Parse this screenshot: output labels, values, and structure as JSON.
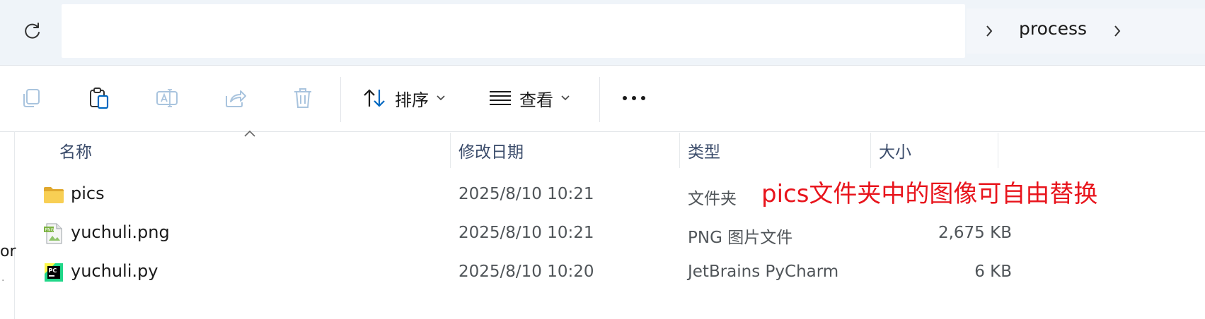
{
  "address_bar": {
    "value": "",
    "breadcrumb": [
      "process"
    ]
  },
  "toolbar": {
    "sort_label": "排序",
    "view_label": "查看"
  },
  "icons": {
    "refresh": "refresh-icon",
    "copy": "copy-icon",
    "paste": "paste-icon",
    "rename": "rename-icon",
    "share": "share-icon",
    "delete": "trash-icon",
    "sort": "sort-icon",
    "view": "view-icon",
    "more": "more-icon"
  },
  "columns": {
    "name": "名称",
    "modified": "修改日期",
    "type": "类型",
    "size": "大小"
  },
  "files": [
    {
      "name": "pics",
      "modified": "2025/8/10 10:21",
      "type": "文件夹",
      "size": "",
      "icon": "folder-icon"
    },
    {
      "name": "yuchuli.png",
      "modified": "2025/8/10 10:21",
      "type": "PNG 图片文件",
      "size": "2,675 KB",
      "icon": "png-file-icon"
    },
    {
      "name": "yuchuli.py",
      "modified": "2025/8/10 10:20",
      "type": "JetBrains PyCharm",
      "size": "6 KB",
      "icon": "pycharm-file-icon"
    }
  ],
  "annotation": "pics文件夹中的图像可自由替换",
  "left_pane_fragment": "or",
  "colors": {
    "annotation": "#e8141c",
    "accent": "#0067c0",
    "folder": "#f4c542"
  }
}
